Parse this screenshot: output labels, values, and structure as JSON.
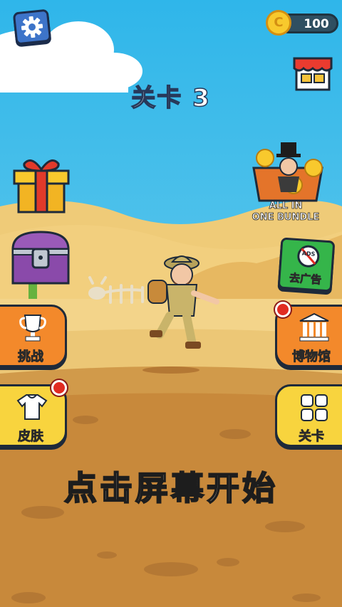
{
  "coins": {
    "count": "100"
  },
  "level": {
    "title": "关卡 3"
  },
  "buttons": {
    "challenge": "挑战",
    "skin": "皮肤",
    "museum": "博物馆",
    "levels": "关卡",
    "no_ads": "去广告",
    "no_ads_badge": "ADS"
  },
  "bundle": {
    "line1": "ALL IN",
    "line2": "ONE BUNDLE"
  },
  "start_prompt": "点击屏幕开始",
  "colors": {
    "sky": "#3fbfe8",
    "sand": "#e6b65a",
    "ground": "#c98a3e",
    "accent_orange": "#f3892b",
    "accent_yellow": "#f8d43e"
  }
}
